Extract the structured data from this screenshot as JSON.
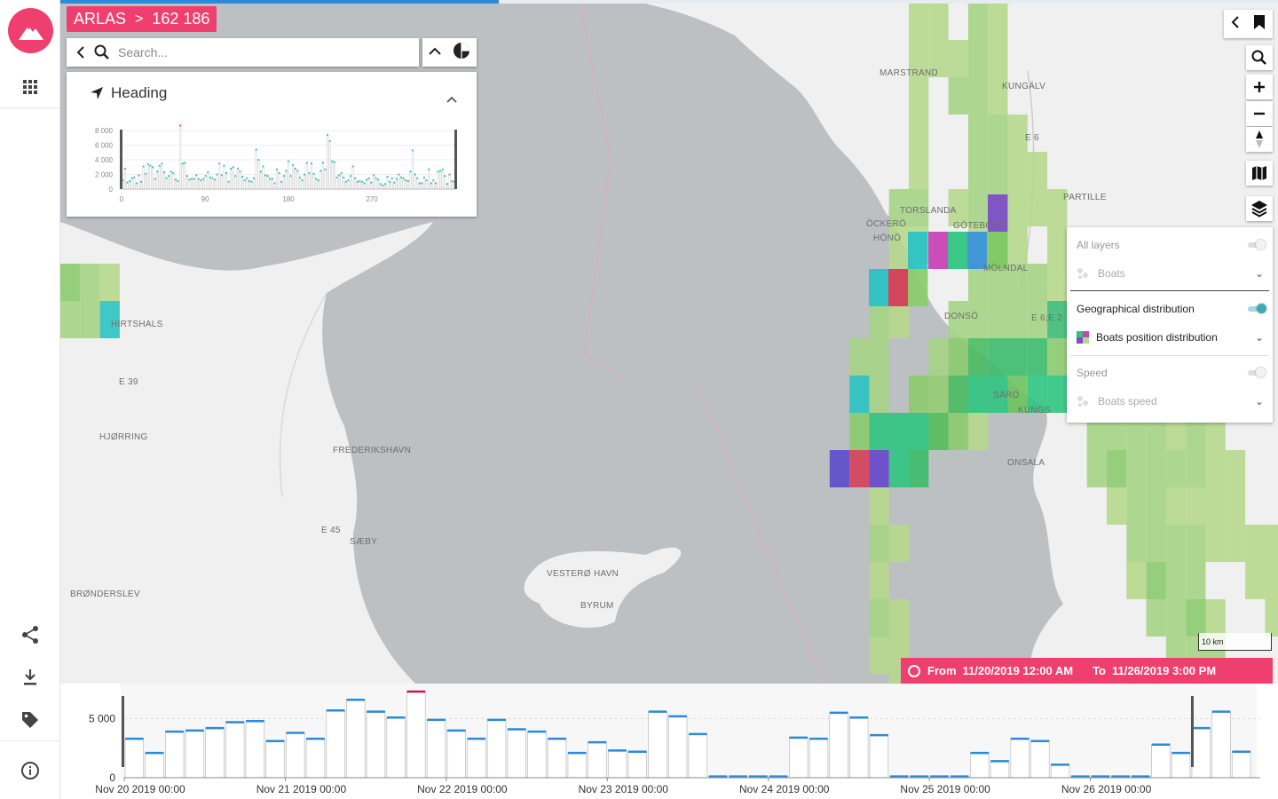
{
  "app": {
    "name": "ARLAS",
    "count": "162 186"
  },
  "search": {
    "placeholder": "Search..."
  },
  "widget": {
    "title": "Heading",
    "chart_data": {
      "type": "bar",
      "title": "Heading",
      "x_ticks": [
        "0",
        "90",
        "180",
        "270"
      ],
      "y_ticks": [
        "0",
        "2 000",
        "4 000",
        "6 000",
        "8 000"
      ],
      "xlim": [
        0,
        360
      ],
      "ylim": [
        0,
        8500
      ],
      "bin_width": 5,
      "values": [
        1200,
        2800,
        900,
        1100,
        1500,
        1600,
        800,
        1900,
        1000,
        3100,
        2100,
        3400,
        3200,
        3000,
        1400,
        2400,
        3200,
        3500,
        2300,
        1500,
        1800,
        2400,
        2200,
        1300,
        1100,
        8700,
        3500,
        3600,
        1800,
        1300,
        1400,
        1400,
        1900,
        1400,
        1200,
        1400,
        1800,
        2300,
        1600,
        1500,
        1300,
        2000,
        3500,
        1900,
        3200,
        2200,
        1000,
        2800,
        3000,
        1800,
        2800,
        2400,
        1700,
        1200,
        1500,
        1100,
        1000,
        1500,
        5400,
        4000,
        2400,
        3100,
        1900,
        1800,
        1400,
        1400,
        800,
        2700,
        2200,
        1000,
        1800,
        2500,
        3800,
        1800,
        3300,
        2800,
        2500,
        1600,
        1200,
        2000,
        3600,
        2200,
        3500,
        2100,
        1400,
        1200,
        2500,
        3600,
        2700,
        7400,
        6600,
        3800,
        3700,
        1600,
        1900,
        2200,
        1600,
        1000,
        1200,
        1800,
        3100,
        1500,
        1000,
        1100,
        1000,
        800,
        1300,
        1500,
        900,
        1900,
        1500,
        1300,
        700,
        500,
        700,
        1700,
        1000,
        1500,
        900,
        1400,
        2000,
        1600,
        1500,
        1200,
        1100,
        2400,
        5300,
        2000,
        1500,
        800,
        800,
        1600,
        1200,
        2700,
        800,
        1200,
        800,
        2400,
        2500,
        2700,
        1800,
        700,
        2000,
        1100,
        1000
      ],
      "selected_range": [
        0,
        360
      ],
      "highlight_bin": 25
    }
  },
  "map": {
    "labels": [
      "MARSTRAND",
      "KUNGÄLV",
      "E 6",
      "PARTILLE",
      "TORSLANDA",
      "ÖCKERÖ",
      "HÖNÖ",
      "GÖTEBORG",
      "MÖLNDAL",
      "DONSÖ",
      "E 6;E 2",
      "SÄRÖ",
      "KUNGS",
      "ONSALA",
      "HIRTSHALS",
      "E 39",
      "HJØRRING",
      "FREDERIKSHAVN",
      "E 45",
      "SÆBY",
      "VESTERØ HAVN",
      "BYRUM",
      "BRØNDERSLEV"
    ],
    "scale": "10 km",
    "colors": {
      "water": "#bcc0c3",
      "land": "#f0f0f0"
    },
    "progress": 0.36,
    "grid_cells": [
      [
        44,
        0,
        "#b5d88d"
      ],
      [
        45,
        0,
        "#b5d88d"
      ],
      [
        47,
        0,
        "#a5d486"
      ],
      [
        48,
        0,
        "#b5d88d"
      ],
      [
        44,
        1,
        "#b5d88d"
      ],
      [
        45,
        1,
        "#b5d88d"
      ],
      [
        46,
        1,
        "#b5d88d"
      ],
      [
        47,
        1,
        "#a5d486"
      ],
      [
        48,
        1,
        "#b5d88d"
      ],
      [
        44,
        2,
        "#b5d88d"
      ],
      [
        46,
        2,
        "#a5d486"
      ],
      [
        47,
        2,
        "#a5d486"
      ],
      [
        48,
        2,
        "#b5d88d"
      ],
      [
        44,
        3,
        "#b5d88d"
      ],
      [
        47,
        3,
        "#a5d486"
      ],
      [
        48,
        3,
        "#a5d486"
      ],
      [
        49,
        3,
        "#b5d88d"
      ],
      [
        44,
        4,
        "#b5d88d"
      ],
      [
        47,
        4,
        "#a5d486"
      ],
      [
        48,
        4,
        "#a5d486"
      ],
      [
        49,
        4,
        "#b5d88d"
      ],
      [
        50,
        4,
        "#b5d88d"
      ],
      [
        43,
        5,
        "#a5d486"
      ],
      [
        44,
        5,
        "#a5d486"
      ],
      [
        47,
        5,
        "#a5d486"
      ],
      [
        48,
        5,
        "#a5d486"
      ],
      [
        49,
        5,
        "#b5d88d"
      ],
      [
        50,
        5,
        "#b5d88d"
      ],
      [
        51,
        5,
        "#b5d88d"
      ],
      [
        43,
        6,
        "#b5d88d"
      ],
      [
        44,
        6,
        "#b5d88d"
      ],
      [
        47,
        6,
        "#b5d88d"
      ],
      [
        48,
        6,
        "#a5d486"
      ],
      [
        49,
        6,
        "#b5d88d"
      ],
      [
        51,
        6,
        "#b5d88d"
      ],
      [
        43,
        7,
        "#b5d88d"
      ],
      [
        47,
        7,
        "#a5d486"
      ],
      [
        48,
        7,
        "#a5d486"
      ],
      [
        49,
        7,
        "#a5d486"
      ],
      [
        50,
        7,
        "#a5d486"
      ],
      [
        51,
        7,
        "#b5d88d"
      ],
      [
        52,
        7,
        "#b5d88d"
      ],
      [
        42,
        8,
        "#a5d486"
      ],
      [
        43,
        8,
        "#b5d88d"
      ],
      [
        46,
        8,
        "#a5d486"
      ],
      [
        47,
        8,
        "#a5d486"
      ],
      [
        48,
        8,
        "#a5d486"
      ],
      [
        49,
        8,
        "#a5d486"
      ],
      [
        50,
        8,
        "#a5d486"
      ],
      [
        51,
        8,
        "#3cbb77"
      ],
      [
        52,
        8,
        "#2ec57f"
      ],
      [
        53,
        8,
        "#2ec57f"
      ],
      [
        54,
        8,
        "#2ec57f"
      ],
      [
        55,
        8,
        "#2ec57f"
      ],
      [
        56,
        8,
        "#2ec57f"
      ],
      [
        57,
        8,
        "#2ec57f"
      ],
      [
        41,
        9,
        "#a5d486"
      ],
      [
        42,
        9,
        "#a5d486"
      ],
      [
        45,
        9,
        "#a5d486"
      ],
      [
        46,
        9,
        "#8ccb6e"
      ],
      [
        47,
        9,
        "#49bb62"
      ],
      [
        48,
        9,
        "#3cbb6a"
      ],
      [
        49,
        9,
        "#3cbb6a"
      ],
      [
        50,
        9,
        "#3cbb6a"
      ],
      [
        51,
        9,
        "#8ccb6e"
      ],
      [
        52,
        9,
        "#a5d486"
      ],
      [
        53,
        9,
        "#a5d486"
      ],
      [
        41,
        10,
        "#2cc3c4"
      ],
      [
        42,
        10,
        "#a5d486"
      ],
      [
        44,
        10,
        "#8ccb6e"
      ],
      [
        45,
        10,
        "#94cd73"
      ],
      [
        46,
        10,
        "#49bb62"
      ],
      [
        47,
        10,
        "#2ec57f"
      ],
      [
        48,
        10,
        "#2ec57f"
      ],
      [
        49,
        10,
        "#6dc35f"
      ],
      [
        50,
        10,
        "#2ec57f"
      ],
      [
        51,
        10,
        "#2ec57f"
      ],
      [
        52,
        10,
        "#3cbb6a"
      ],
      [
        53,
        10,
        "#8ccb6e"
      ],
      [
        54,
        10,
        "#a5d486"
      ],
      [
        55,
        10,
        "#8ccb6e"
      ],
      [
        56,
        10,
        "#a5d486"
      ],
      [
        57,
        10,
        "#a5d486"
      ],
      [
        58,
        10,
        "#a5d486"
      ],
      [
        59,
        10,
        "#b5d88d"
      ],
      [
        41,
        11,
        "#8ccb6e"
      ],
      [
        42,
        11,
        "#2ec57f"
      ],
      [
        43,
        11,
        "#2ec57f"
      ],
      [
        44,
        11,
        "#2ec57f"
      ],
      [
        45,
        11,
        "#52be5a"
      ],
      [
        46,
        11,
        "#8ccb6e"
      ],
      [
        47,
        11,
        "#b5d88d"
      ],
      [
        53,
        11,
        "#a5d486"
      ],
      [
        54,
        11,
        "#a5d486"
      ],
      [
        55,
        11,
        "#a5d486"
      ],
      [
        56,
        11,
        "#a5d486"
      ],
      [
        57,
        11,
        "#b5d88d"
      ],
      [
        58,
        11,
        "#a5d486"
      ],
      [
        59,
        11,
        "#b5d88d"
      ],
      [
        40,
        12,
        "#5b4acd"
      ],
      [
        41,
        12,
        "#d63e5a"
      ],
      [
        42,
        12,
        "#6446cd"
      ],
      [
        43,
        12,
        "#2ec57f"
      ],
      [
        44,
        12,
        "#3cbb6a"
      ],
      [
        53,
        12,
        "#a5d486"
      ],
      [
        54,
        12,
        "#8ccb6e"
      ],
      [
        55,
        12,
        "#a5d486"
      ],
      [
        56,
        12,
        "#a5d486"
      ],
      [
        57,
        12,
        "#a5d486"
      ],
      [
        58,
        12,
        "#a5d486"
      ],
      [
        59,
        12,
        "#b5d88d"
      ],
      [
        60,
        12,
        "#b5d88d"
      ],
      [
        42,
        13,
        "#b5d88d"
      ],
      [
        54,
        13,
        "#b5d88d"
      ],
      [
        55,
        13,
        "#a5d486"
      ],
      [
        56,
        13,
        "#a5d486"
      ],
      [
        57,
        13,
        "#b5d88d"
      ],
      [
        58,
        13,
        "#b5d88d"
      ],
      [
        59,
        13,
        "#b5d88d"
      ],
      [
        60,
        13,
        "#b5d88d"
      ],
      [
        42,
        14,
        "#a5d486"
      ],
      [
        43,
        14,
        "#b5d88d"
      ],
      [
        55,
        14,
        "#a5d486"
      ],
      [
        56,
        14,
        "#a5d486"
      ],
      [
        57,
        14,
        "#a5d486"
      ],
      [
        58,
        14,
        "#a5d486"
      ],
      [
        59,
        14,
        "#b5d88d"
      ],
      [
        60,
        14,
        "#b5d88d"
      ],
      [
        61,
        14,
        "#b5d88d"
      ],
      [
        62,
        14,
        "#b5d88d"
      ],
      [
        42,
        15,
        "#b5d88d"
      ],
      [
        55,
        15,
        "#b5d88d"
      ],
      [
        56,
        15,
        "#8ccb6e"
      ],
      [
        57,
        15,
        "#a5d486"
      ],
      [
        58,
        15,
        "#a5d486"
      ],
      [
        61,
        15,
        "#b5d88d"
      ],
      [
        62,
        15,
        "#b5d88d"
      ],
      [
        63,
        15,
        "#b5d88d"
      ],
      [
        42,
        16,
        "#a5d486"
      ],
      [
        43,
        16,
        "#b5d88d"
      ],
      [
        56,
        16,
        "#a5d486"
      ],
      [
        57,
        16,
        "#a5d486"
      ],
      [
        58,
        16,
        "#8ccb6e"
      ],
      [
        59,
        16,
        "#b5d88d"
      ],
      [
        62,
        16,
        "#b5d88d"
      ],
      [
        63,
        16,
        "#b5d88d"
      ],
      [
        42,
        17,
        "#b5d88d"
      ],
      [
        43,
        17,
        "#b5d88d"
      ],
      [
        57,
        17,
        "#a5d486"
      ],
      [
        58,
        17,
        "#a5d486"
      ],
      [
        59,
        17,
        "#a5d486"
      ],
      [
        63,
        17,
        "#b5d88d"
      ],
      [
        64,
        17,
        "#b5d88d"
      ],
      [
        43,
        18,
        "#b5d88d"
      ],
      [
        58,
        18,
        "#a5d486"
      ],
      [
        59,
        18,
        "#a5d486"
      ],
      [
        60,
        18,
        "#a5d486"
      ],
      [
        0,
        7,
        "#8ccb6e"
      ],
      [
        1,
        7,
        "#a5d486"
      ],
      [
        2,
        7,
        "#b5d88d"
      ],
      [
        0,
        8,
        "#a5d486"
      ],
      [
        1,
        8,
        "#a5d486"
      ],
      [
        2,
        8,
        "#2cc3c4"
      ],
      [
        46,
        5,
        "#b5d88d"
      ]
    ],
    "goteborg_cells": [
      [
        1113,
        219,
        "#7e4ec8"
      ],
      [
        1023,
        261,
        "#2cc3c4"
      ],
      [
        1046,
        261,
        "#c844b4"
      ],
      [
        1068,
        261,
        "#2ec57f"
      ],
      [
        1090,
        261,
        "#3a94d8"
      ],
      [
        1113,
        261,
        "#80c965"
      ],
      [
        979,
        303,
        "#2cc3c4"
      ],
      [
        1001,
        303,
        "#d63e5a"
      ],
      [
        1023,
        303,
        "#8ccb6e"
      ]
    ]
  },
  "layers": {
    "all_layers": "All layers",
    "boats": "Boats",
    "geo": "Geographical distribution",
    "boats_position": "Boats position distribution",
    "speed": "Speed",
    "boats_speed": "Boats speed"
  },
  "timerange": {
    "from_label": "From",
    "from": "11/20/2019 12:00 AM",
    "to_label": "To",
    "to": "11/26/2019 3:00 PM"
  },
  "timeline": {
    "chart_data": {
      "type": "bar",
      "x_ticks": [
        "Nov 20 2019 00:00",
        "Nov 21 2019 00:00",
        "Nov 22 2019 00:00",
        "Nov 23 2019 00:00",
        "Nov 24 2019 00:00",
        "Nov 25 2019 00:00",
        "Nov 26 2019 00:00"
      ],
      "y_ticks": [
        "0",
        "5 000"
      ],
      "ylim": [
        0,
        7600
      ],
      "bin_hours": 3,
      "values": [
        3300,
        2100,
        3900,
        4000,
        4200,
        4700,
        4800,
        3100,
        3800,
        3300,
        5700,
        6600,
        5600,
        5100,
        7300,
        4900,
        4000,
        3300,
        4900,
        4100,
        3900,
        3300,
        2100,
        3000,
        2300,
        2200,
        5600,
        5200,
        3700,
        100,
        100,
        100,
        100,
        3400,
        3300,
        5500,
        5100,
        3600,
        100,
        100,
        100,
        100,
        2100,
        1400,
        3300,
        3100,
        1100,
        100,
        100,
        100,
        100,
        2800,
        2100,
        4200,
        5600,
        2200
      ],
      "highlight_bin": 14
    }
  },
  "colors": {
    "accent": "#ef3f6e",
    "bar_top": "#2b8ad8",
    "heading_top": "#36c1b8"
  }
}
